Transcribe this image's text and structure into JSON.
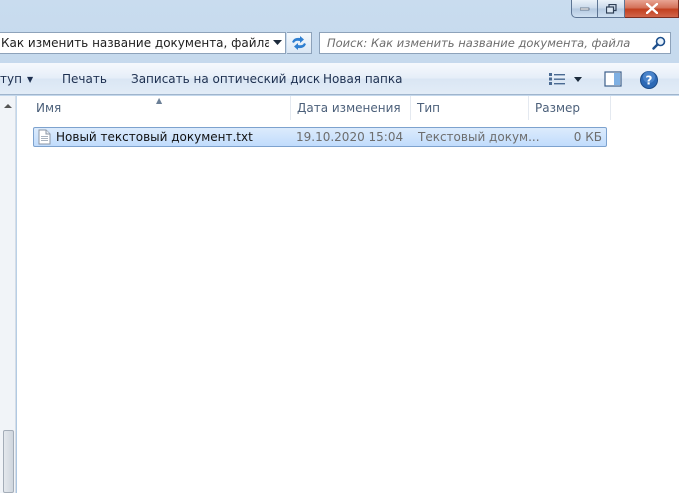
{
  "address": {
    "path": "Как изменить название документа, файла"
  },
  "search": {
    "placeholder": "Поиск: Как изменить название документа, файла"
  },
  "toolbar": {
    "share_label": "туп",
    "print_label": "Печать",
    "burn_label": "Записать на оптический диск",
    "new_folder_label": "Новая папка"
  },
  "columns": {
    "name": "Имя",
    "date": "Дата изменения",
    "type": "Тип",
    "size": "Размер"
  },
  "files": [
    {
      "name": "Новый текстовый документ.txt",
      "date": "19.10.2020 15:04",
      "type": "Текстовый докум...",
      "size": "0 КБ",
      "icon": "text-document-icon"
    }
  ],
  "colors": {
    "selection_bg": "#c8e0fc",
    "selection_border": "#7da2ce",
    "close_button": "#c2401f",
    "toolbar_text": "#1e3050"
  }
}
